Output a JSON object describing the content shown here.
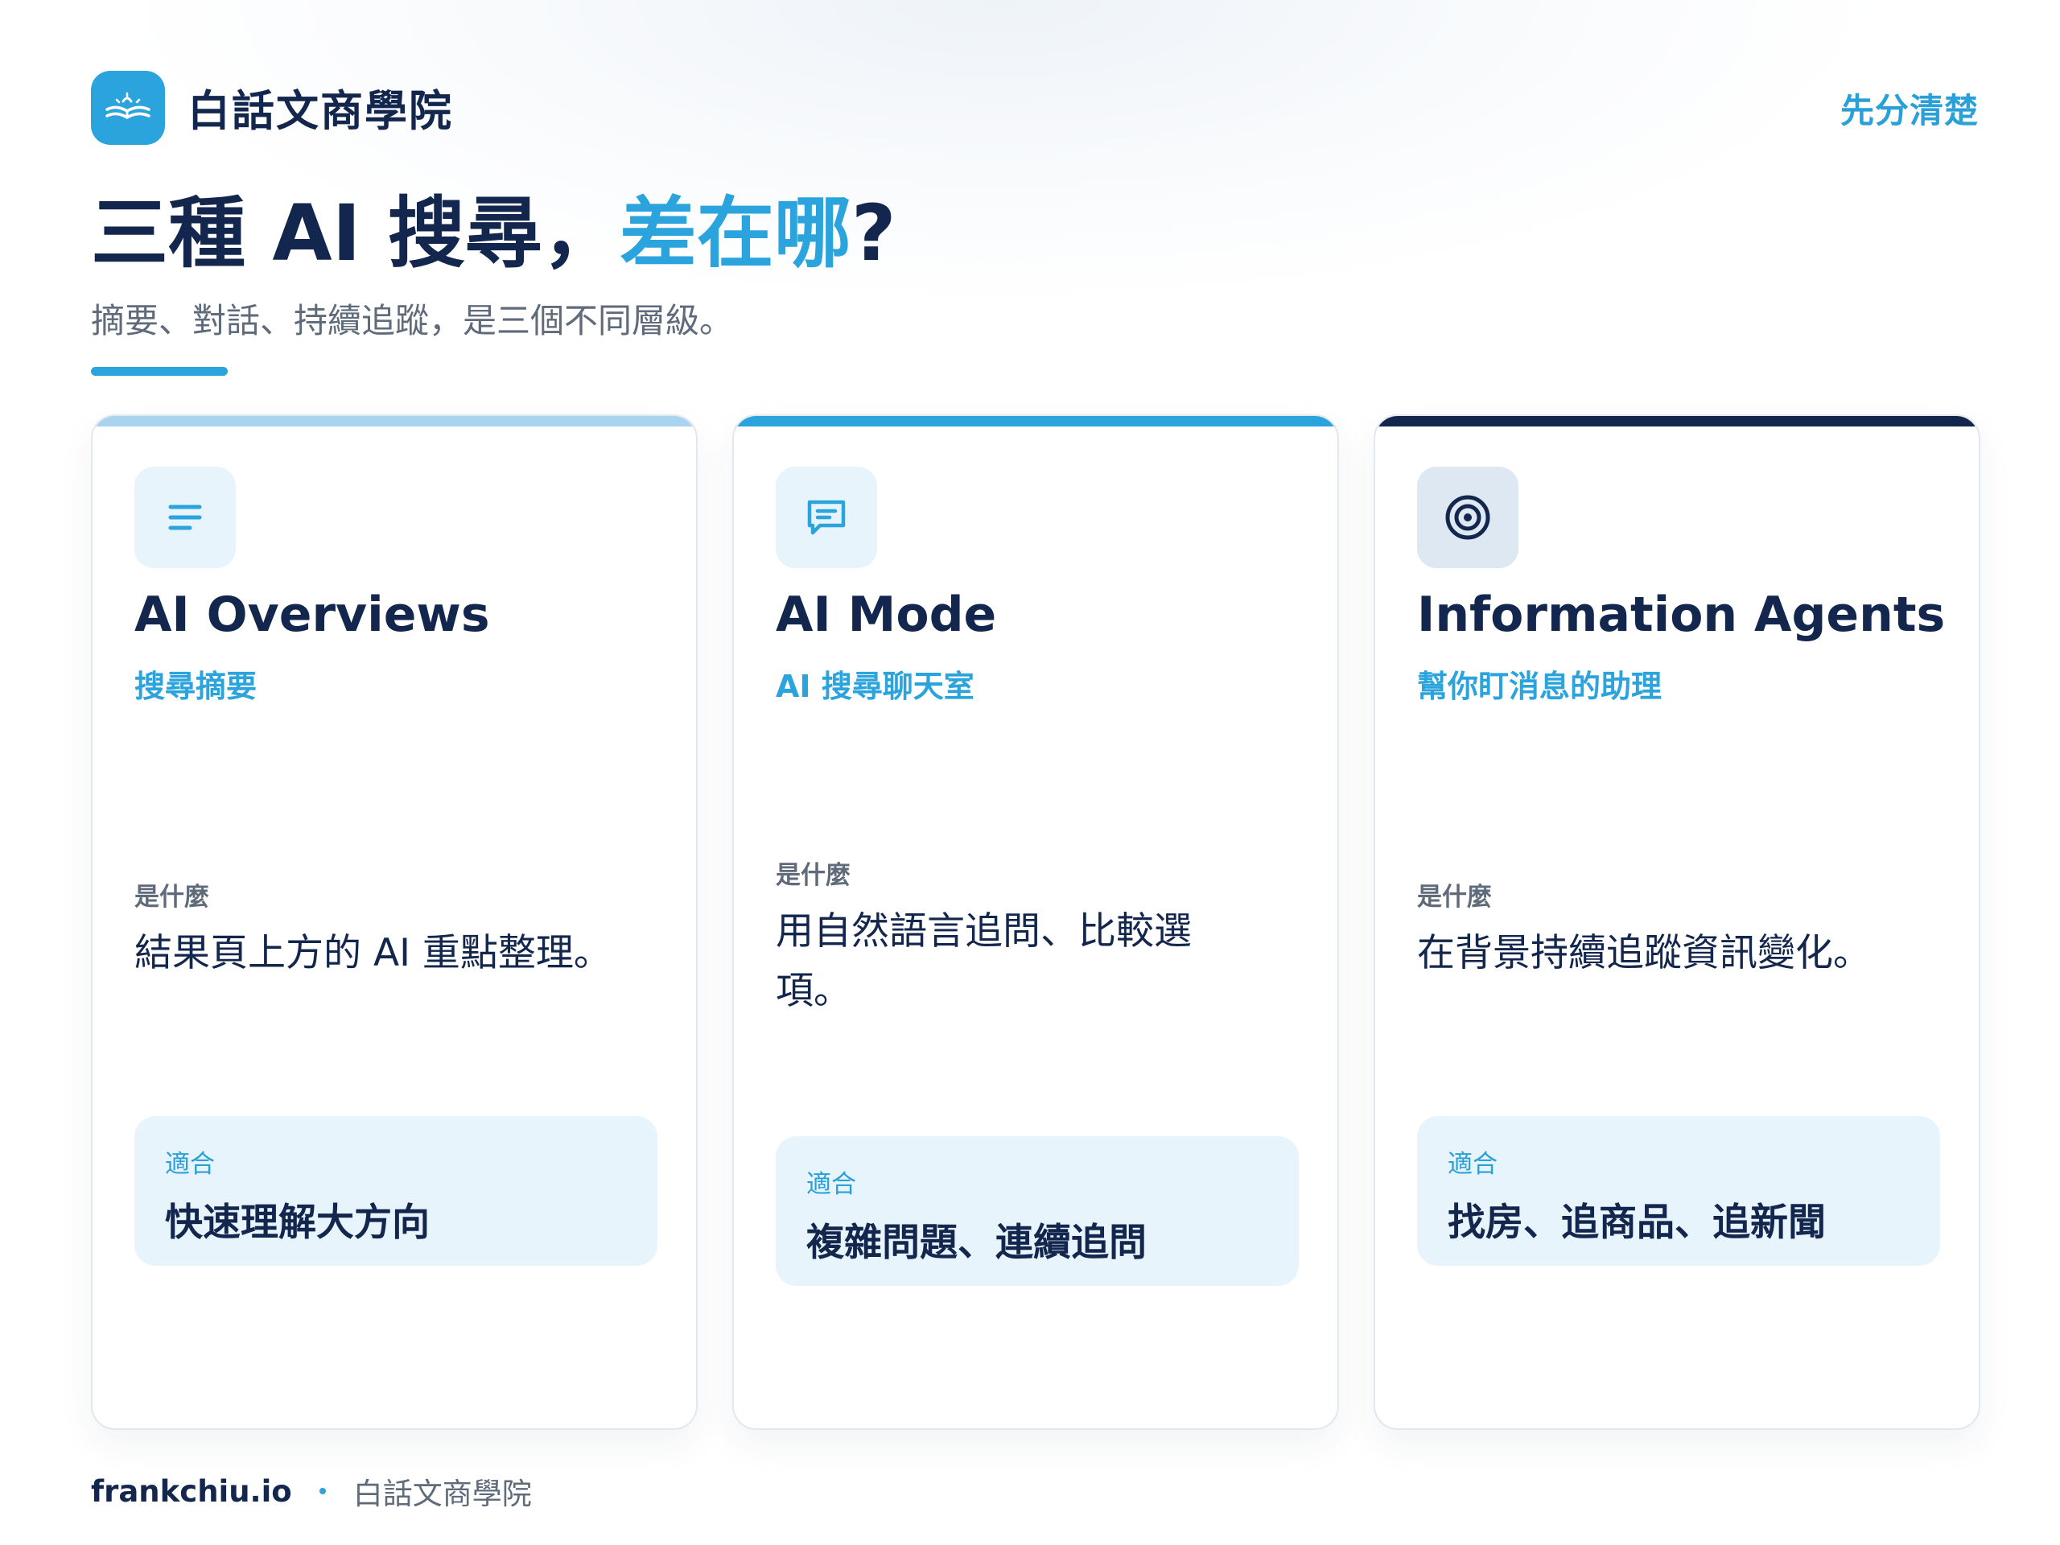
{
  "brand": {
    "name": "白話文商學院",
    "logo_icon": "open-book-icon"
  },
  "tag": "先分清楚",
  "headline": {
    "part1": "三種 AI 搜尋，",
    "highlight": "差在哪",
    "part2": "?"
  },
  "subtitle": "摘要、對話、持續追蹤，是三個不同層級。",
  "cards": [
    {
      "icon": "text-lines-icon",
      "accent": "#a9d4ef",
      "title": "AI Overviews",
      "subtitle": "搜尋摘要",
      "what_label": "是什麼",
      "what_text": "結果頁上方的 AI 重點整理。",
      "fit_label": "適合",
      "fit_text": "快速理解大方向"
    },
    {
      "icon": "chat-bubble-icon",
      "accent": "#2ba3dc",
      "title": "AI Mode",
      "subtitle": "AI 搜尋聊天室",
      "what_label": "是什麼",
      "what_text": "用自然語言追問、比較選項。",
      "fit_label": "適合",
      "fit_text": "複雜問題、連續追問"
    },
    {
      "icon": "target-icon",
      "accent": "#13264d",
      "title": "Information Agents",
      "subtitle": "幫你盯消息的助理",
      "what_label": "是什麼",
      "what_text": "在背景持續追蹤資訊變化。",
      "fit_label": "適合",
      "fit_text": "找房、追商品、追新聞"
    }
  ],
  "footer": {
    "site": "frankchiu.io",
    "brand": "白話文商學院"
  },
  "colors": {
    "navy": "#13264d",
    "blue": "#2ba3dc",
    "light_blue": "#e8f4fc",
    "gray": "#5f6b7a"
  }
}
